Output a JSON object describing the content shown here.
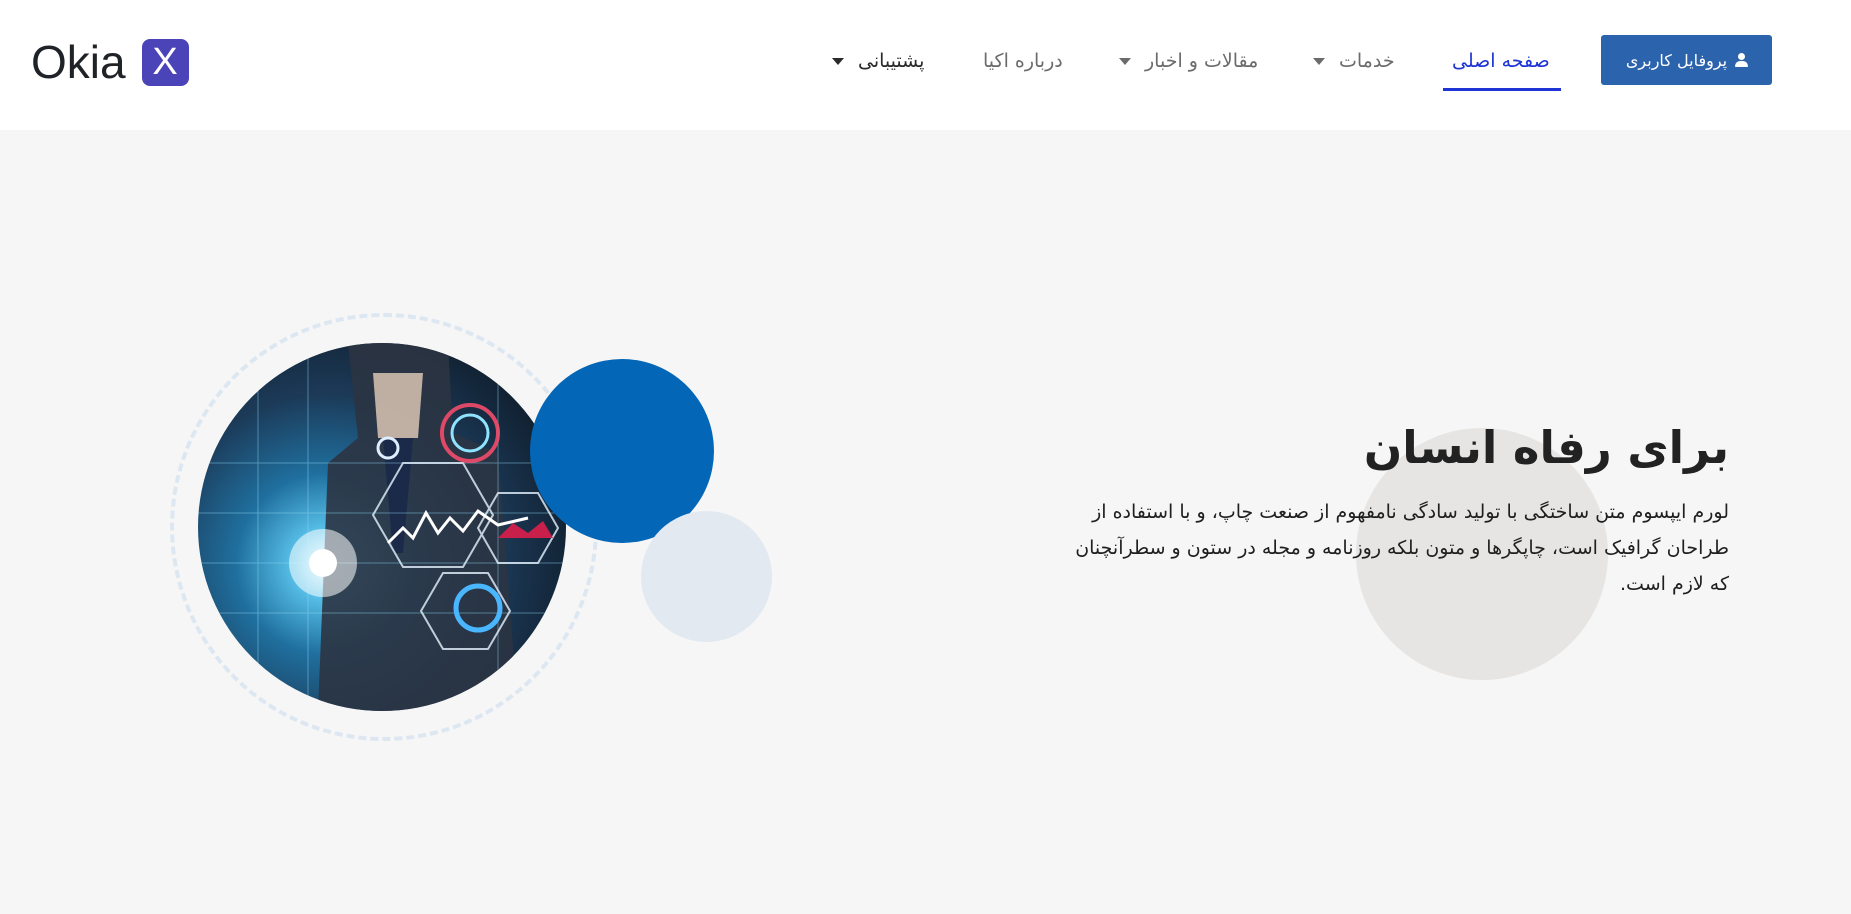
{
  "header": {
    "logo": {
      "text": "Okia",
      "badge": "X"
    },
    "nav": {
      "home": "صفحه اصلی",
      "services": "خدمات",
      "articles": "مقالات و اخبار",
      "about": "درباره اکیا",
      "support": "پشتیبانی"
    },
    "profile_button": "پروفایل کاربری"
  },
  "hero": {
    "title": "برای رفاه انسان",
    "body": "لورم ایپسوم متن ساختگی با تولید سادگی نامفهوم از صنعت چاپ، و با استفاده از طراحان گرافیک است، چاپگرها و متون بلکه روزنامه و مجله در ستون و سطرآنچنان که لازم است."
  },
  "colors": {
    "brand": "#4b44b8",
    "button": "#2b63ad",
    "active_link": "#1e34d4",
    "accent_circle": "#0466b6"
  },
  "icons": {
    "profile": "user-icon",
    "dropdown": "caret-down-icon"
  }
}
